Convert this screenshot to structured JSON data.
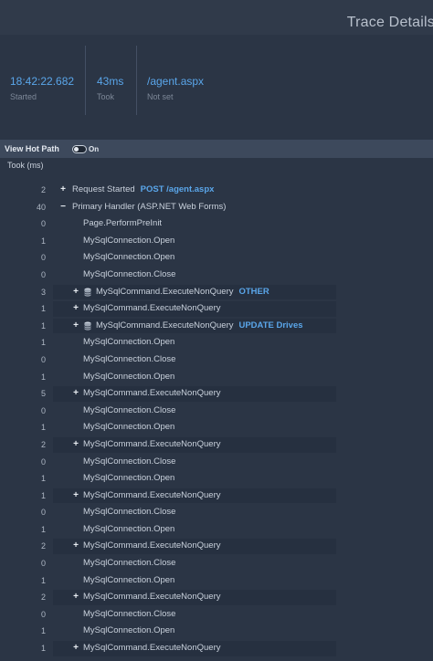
{
  "header": {
    "title": "Trace Details"
  },
  "stats": [
    {
      "value": "18:42:22.682",
      "label": "Started"
    },
    {
      "value": "43ms",
      "label": "Took"
    },
    {
      "value": "/agent.aspx",
      "label": "Not set"
    }
  ],
  "hotpath": {
    "label": "View Hot Path",
    "state": "On",
    "enabled": true
  },
  "table": {
    "took_header": "Took (ms)"
  },
  "colors": {
    "accent": "#5aa6ea",
    "background": "#2b3545",
    "bar": "#3d495c"
  },
  "rows": [
    {
      "took": "2",
      "toggle": "+",
      "icon": "",
      "name": "Request Started",
      "info": "POST /agent.aspx",
      "depth": 0
    },
    {
      "took": "40",
      "toggle": "−",
      "icon": "",
      "name": "Primary Handler (ASP.NET Web Forms)",
      "info": "",
      "depth": 0
    },
    {
      "took": "0",
      "toggle": "",
      "icon": "",
      "name": "Page.PerformPreInit",
      "info": "",
      "depth": 1
    },
    {
      "took": "1",
      "toggle": "",
      "icon": "",
      "name": "MySqlConnection.Open",
      "info": "",
      "depth": 1
    },
    {
      "took": "0",
      "toggle": "",
      "icon": "",
      "name": "MySqlConnection.Open",
      "info": "",
      "depth": 1
    },
    {
      "took": "0",
      "toggle": "",
      "icon": "",
      "name": "MySqlConnection.Close",
      "info": "",
      "depth": 1
    },
    {
      "took": "3",
      "toggle": "+",
      "icon": "database-icon",
      "name": "MySqlCommand.ExecuteNonQuery",
      "info": "OTHER",
      "depth": 1
    },
    {
      "took": "1",
      "toggle": "+",
      "icon": "",
      "name": "MySqlCommand.ExecuteNonQuery",
      "info": "",
      "depth": 1
    },
    {
      "took": "1",
      "toggle": "+",
      "icon": "database-icon",
      "name": "MySqlCommand.ExecuteNonQuery",
      "info": "UPDATE Drives",
      "depth": 1
    },
    {
      "took": "1",
      "toggle": "",
      "icon": "",
      "name": "MySqlConnection.Open",
      "info": "",
      "depth": 1
    },
    {
      "took": "0",
      "toggle": "",
      "icon": "",
      "name": "MySqlConnection.Close",
      "info": "",
      "depth": 1
    },
    {
      "took": "1",
      "toggle": "",
      "icon": "",
      "name": "MySqlConnection.Open",
      "info": "",
      "depth": 1
    },
    {
      "took": "5",
      "toggle": "+",
      "icon": "",
      "name": "MySqlCommand.ExecuteNonQuery",
      "info": "",
      "depth": 1
    },
    {
      "took": "0",
      "toggle": "",
      "icon": "",
      "name": "MySqlConnection.Close",
      "info": "",
      "depth": 1
    },
    {
      "took": "1",
      "toggle": "",
      "icon": "",
      "name": "MySqlConnection.Open",
      "info": "",
      "depth": 1
    },
    {
      "took": "2",
      "toggle": "+",
      "icon": "",
      "name": "MySqlCommand.ExecuteNonQuery",
      "info": "",
      "depth": 1
    },
    {
      "took": "0",
      "toggle": "",
      "icon": "",
      "name": "MySqlConnection.Close",
      "info": "",
      "depth": 1
    },
    {
      "took": "1",
      "toggle": "",
      "icon": "",
      "name": "MySqlConnection.Open",
      "info": "",
      "depth": 1
    },
    {
      "took": "1",
      "toggle": "+",
      "icon": "",
      "name": "MySqlCommand.ExecuteNonQuery",
      "info": "",
      "depth": 1
    },
    {
      "took": "0",
      "toggle": "",
      "icon": "",
      "name": "MySqlConnection.Close",
      "info": "",
      "depth": 1
    },
    {
      "took": "1",
      "toggle": "",
      "icon": "",
      "name": "MySqlConnection.Open",
      "info": "",
      "depth": 1
    },
    {
      "took": "2",
      "toggle": "+",
      "icon": "",
      "name": "MySqlCommand.ExecuteNonQuery",
      "info": "",
      "depth": 1
    },
    {
      "took": "0",
      "toggle": "",
      "icon": "",
      "name": "MySqlConnection.Close",
      "info": "",
      "depth": 1
    },
    {
      "took": "1",
      "toggle": "",
      "icon": "",
      "name": "MySqlConnection.Open",
      "info": "",
      "depth": 1
    },
    {
      "took": "2",
      "toggle": "+",
      "icon": "",
      "name": "MySqlCommand.ExecuteNonQuery",
      "info": "",
      "depth": 1
    },
    {
      "took": "0",
      "toggle": "",
      "icon": "",
      "name": "MySqlConnection.Close",
      "info": "",
      "depth": 1
    },
    {
      "took": "1",
      "toggle": "",
      "icon": "",
      "name": "MySqlConnection.Open",
      "info": "",
      "depth": 1
    },
    {
      "took": "1",
      "toggle": "+",
      "icon": "",
      "name": "MySqlCommand.ExecuteNonQuery",
      "info": "",
      "depth": 1
    }
  ]
}
